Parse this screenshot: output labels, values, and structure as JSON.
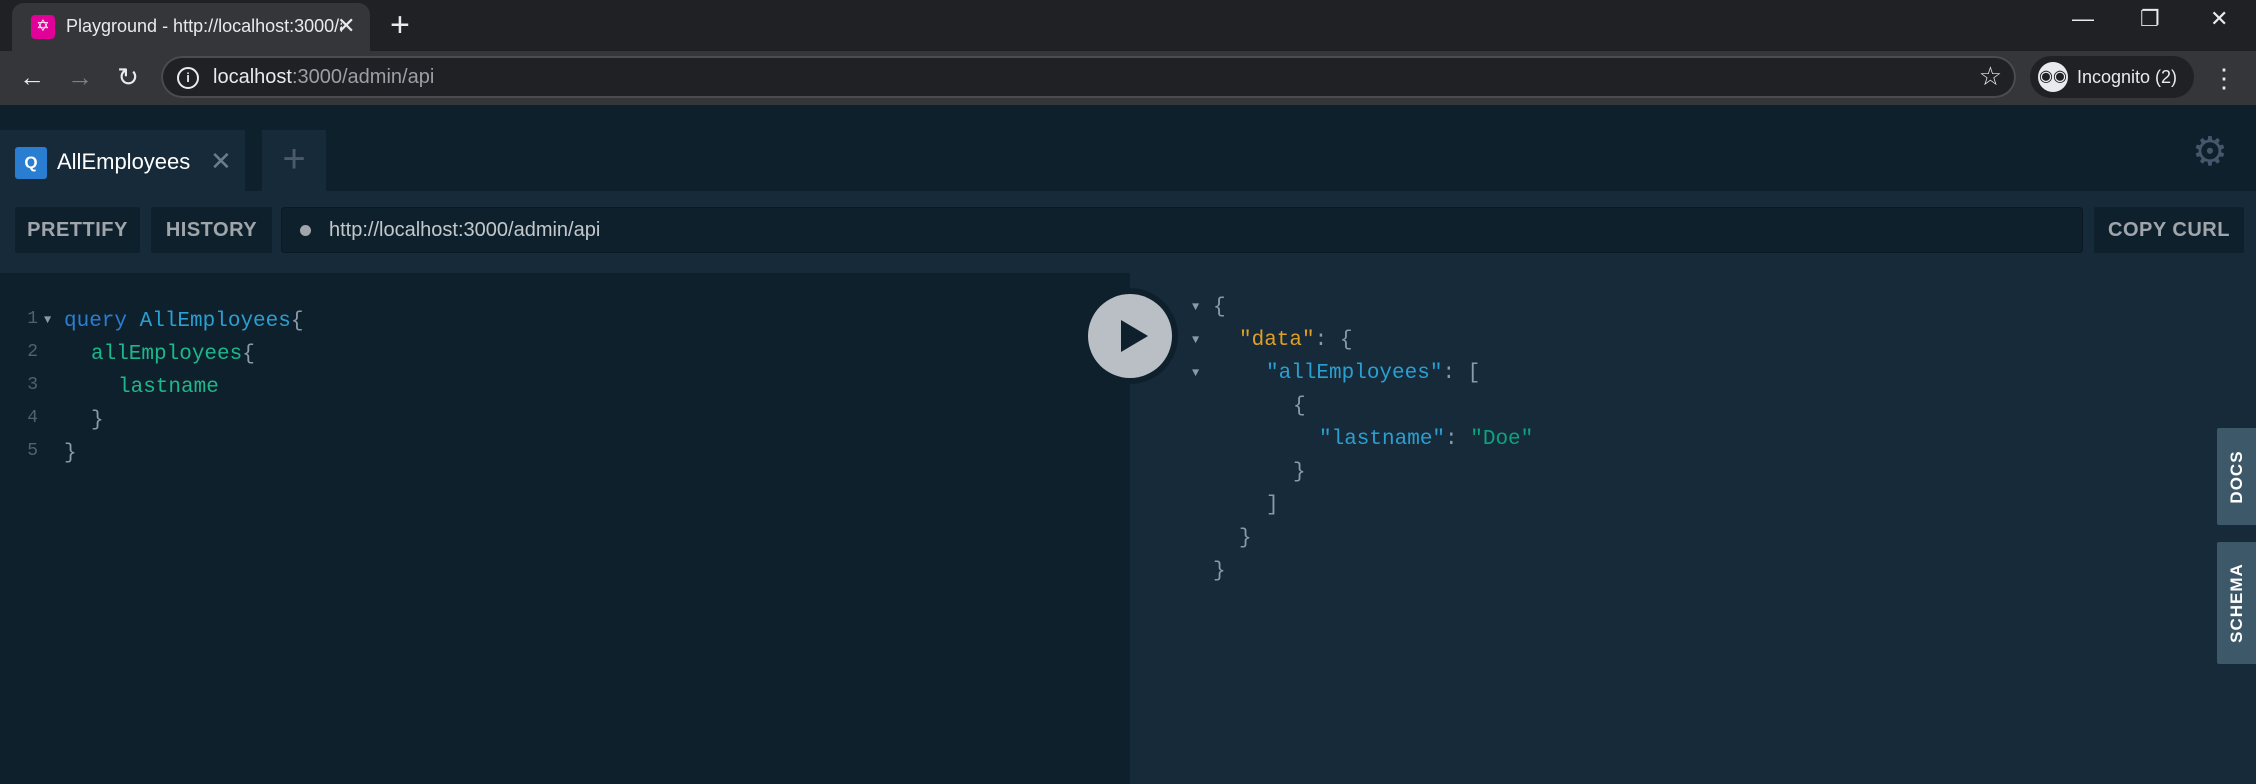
{
  "browser": {
    "tab_title": "Playground - http://localhost:3000/admin/api",
    "tab_favicon": "graphql-icon",
    "url_host": "localhost",
    "url_rest": ":3000/admin/api",
    "profile_label": "Incognito (2)"
  },
  "playground": {
    "active_tab": {
      "badge": "Q",
      "name": "AllEmployees"
    },
    "toolbar": {
      "prettify": "PRETTIFY",
      "history": "HISTORY",
      "endpoint": "http://localhost:3000/admin/api",
      "copy_curl": "COPY CURL"
    },
    "query_lines": [
      {
        "num": "1",
        "text": "query AllEmployees{"
      },
      {
        "num": "2",
        "text": "allEmployees{"
      },
      {
        "num": "3",
        "text": "lastname"
      },
      {
        "num": "4",
        "text": "}"
      },
      {
        "num": "5",
        "text": "}"
      }
    ],
    "query": {
      "keyword": "query",
      "operation": "AllEmployees",
      "field": "allEmployees",
      "subfield": "lastname",
      "open_brace": "{",
      "close_brace": "}"
    },
    "result": {
      "data_key": "\"data\"",
      "list_key": "\"allEmployees\"",
      "item_key": "\"lastname\"",
      "item_value": "\"Doe\""
    },
    "side_tabs": {
      "docs": "DOCS",
      "schema": "SCHEMA"
    }
  },
  "colors": {
    "keyword": "#2a7ed2",
    "field": "#1cb88a",
    "json_key": "#2a9fd1",
    "json_data_key": "#e0a023",
    "json_string": "#0ba47d"
  }
}
